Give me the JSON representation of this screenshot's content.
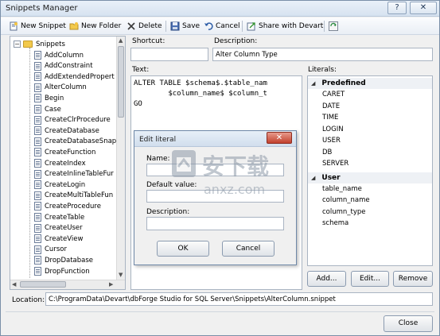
{
  "window": {
    "title": "Snippets Manager",
    "help_label": "?",
    "close_label": "✕"
  },
  "toolbar": {
    "new_snippet": "New Snippet",
    "new_folder": "New Folder",
    "delete": "Delete",
    "save": "Save",
    "cancel": "Cancel",
    "share": "Share with Devart"
  },
  "tree": {
    "root": "Snippets",
    "items": [
      "AddColumn",
      "AddConstraint",
      "AddExtendedPropert",
      "AlterColumn",
      "Begin",
      "Case",
      "CreateClrProcedure",
      "CreateDatabase",
      "CreateDatabaseSnap",
      "CreateFunction",
      "CreateIndex",
      "CreateInlineTableFur",
      "CreateLogin",
      "CreateMultiTableFun",
      "CreateProcedure",
      "CreateTable",
      "CreateUser",
      "CreateView",
      "Cursor",
      "DropDatabase",
      "DropFunction"
    ]
  },
  "shortcut": {
    "label": "Shortcut:",
    "value": ""
  },
  "description": {
    "label": "Description:",
    "value": "Alter Column Type"
  },
  "text": {
    "label": "Text:",
    "lines": [
      "ALTER TABLE $schema$.$table_nam",
      "        $column_name$ $column_t",
      "GO"
    ]
  },
  "literals": {
    "label": "Literals:",
    "groups": [
      {
        "name": "Predefined",
        "items": [
          "CARET",
          "DATE",
          "TIME",
          "LOGIN",
          "USER",
          "DB",
          "SERVER"
        ]
      },
      {
        "name": "User",
        "items": [
          "table_name",
          "column_name",
          "column_type",
          "schema"
        ]
      }
    ],
    "add_button": "Add...",
    "edit_button": "Edit...",
    "remove_button": "Remove"
  },
  "dialog": {
    "title": "Edit literal",
    "name_label": "Name:",
    "default_label": "Default value:",
    "description_label": "Description:",
    "ok_button": "OK",
    "cancel_button": "Cancel"
  },
  "location": {
    "label": "Location:",
    "value": "C:\\ProgramData\\Devart\\dbForge Studio for SQL Server\\Snippets\\AlterColumn.snippet"
  },
  "close_button": "Close",
  "watermark": {
    "text": "安下载",
    "subtext": "anxz.com"
  }
}
